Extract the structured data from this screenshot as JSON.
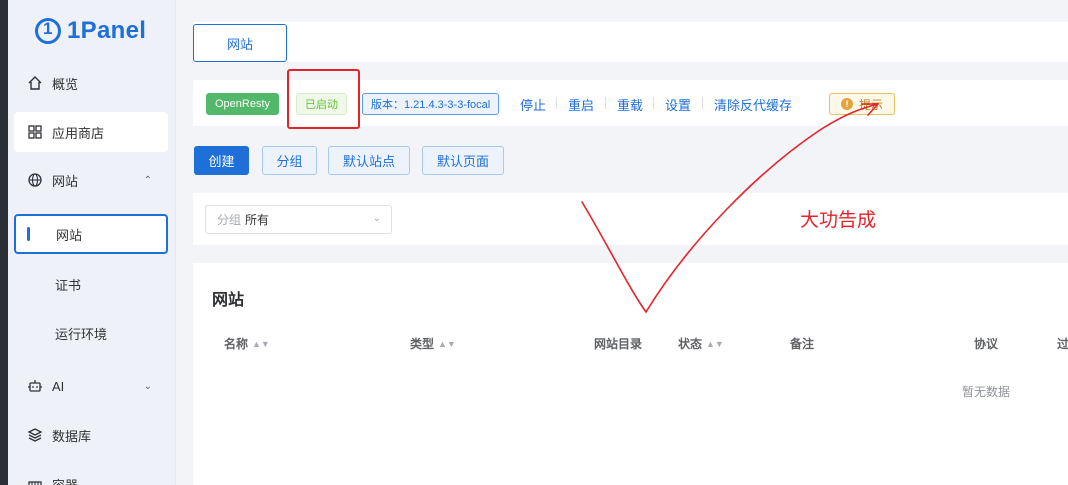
{
  "app": {
    "logo_text": "1Panel"
  },
  "sidebar": {
    "items": [
      {
        "label": "概览",
        "icon": "home-icon"
      },
      {
        "label": "应用商店",
        "icon": "apps-grid-icon"
      },
      {
        "label": "网站",
        "icon": "globe-icon",
        "expanded": true
      },
      {
        "label": "网站",
        "active": true
      },
      {
        "label": "证书"
      },
      {
        "label": "运行环境"
      },
      {
        "label": "AI",
        "icon": "robot-icon"
      },
      {
        "label": "数据库",
        "icon": "database-icon"
      },
      {
        "label": "容器",
        "icon": "container-icon"
      }
    ]
  },
  "tabs": {
    "active": "网站"
  },
  "status": {
    "app_name": "OpenResty",
    "state": "已启动",
    "version": "版本：1.21.4.3-3-3-focal",
    "actions": [
      "停止",
      "重启",
      "重载",
      "设置",
      "清除反代缓存"
    ],
    "tip": "提示"
  },
  "toolbar": {
    "create": "创建",
    "group": "分组",
    "default_site": "默认站点",
    "default_page": "默认页面"
  },
  "filter": {
    "label": "分组",
    "value": "所有"
  },
  "table": {
    "title": "网站",
    "headers": [
      "名称",
      "类型",
      "网站目录",
      "状态",
      "备注",
      "协议",
      "过"
    ],
    "empty_text": "暂无数据"
  },
  "annotation": {
    "text": "大功告成",
    "color": "#e3242b"
  },
  "colors": {
    "primary": "#1f6fd8",
    "success": "#52b86a",
    "annotation": "#e3242b"
  }
}
